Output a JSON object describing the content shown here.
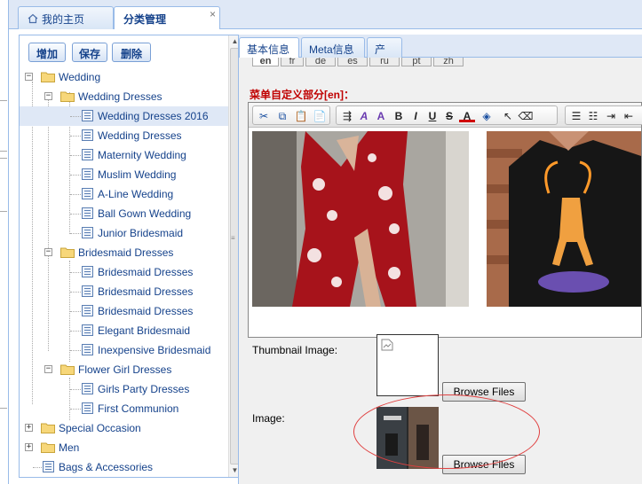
{
  "top_tabs": [
    {
      "label": "我的主页",
      "icon": "home-icon"
    },
    {
      "label": "分类管理",
      "close": "×"
    }
  ],
  "toolbar": {
    "add_label": "增加",
    "save_label": "保存",
    "delete_label": "删除"
  },
  "tree": {
    "wedding": "Wedding",
    "wedding_dresses": "Wedding Dresses",
    "wedding_dresses_2016": "Wedding Dresses 2016",
    "wedding_dresses_b": "Wedding Dresses",
    "maternity_wedding": "Maternity Wedding",
    "muslim_wedding": "Muslim Wedding",
    "a_line_wedding": "A-Line Wedding",
    "ball_gown_wedding": "Ball Gown Wedding",
    "junior_bridesmaid": "Junior Bridesmaid",
    "bridesmaid_dresses": "Bridesmaid Dresses",
    "bridesmaid_dresses_1": "Bridesmaid Dresses",
    "bridesmaid_dresses_2": "Bridesmaid Dresses",
    "bridesmaid_dresses_3": "Bridesmaid Dresses",
    "elegant_bridesmaid": "Elegant Bridesmaid",
    "inexpensive_bridesmaid": "Inexpensive Bridesmaid",
    "flower_girl_dresses": "Flower Girl Dresses",
    "girls_party_dresses": "Girls Party Dresses",
    "first_communion": "First Communion",
    "special_occasion": "Special Occasion",
    "men": "Men",
    "bags_accessories": "Bags & Accessories",
    "expand_symbol": "+",
    "collapse_symbol": "−"
  },
  "right_tabs": [
    "基本信息",
    "Meta信息",
    "产品"
  ],
  "lang_tabs": [
    "en",
    "fr",
    "de",
    "es",
    "ru",
    "pt",
    "zh"
  ],
  "editor": {
    "section_label": "菜单自定义部分[en]："
  },
  "form": {
    "thumbnail_label": "Thumbnail Image:",
    "image_label": "Image:",
    "browse_label": "Browse Files"
  }
}
